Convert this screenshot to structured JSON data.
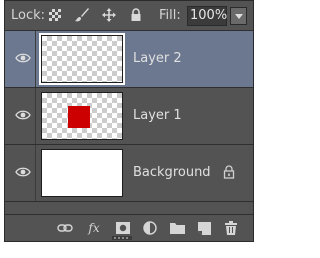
{
  "topbar": {
    "lock_label": "Lock:",
    "lock_icons": [
      "lock-transparent-pixels-icon",
      "lock-image-pixels-icon",
      "lock-position-icon",
      "lock-all-icon"
    ],
    "fill_label": "Fill:",
    "fill_value": "100%"
  },
  "layers": [
    {
      "name": "Layer 2",
      "selected": true,
      "thumbnail": "transparent",
      "visible": true,
      "locked": false
    },
    {
      "name": "Layer 1",
      "selected": false,
      "thumbnail": "red-square-on-transparent",
      "visible": true,
      "locked": false
    },
    {
      "name": "Background",
      "selected": false,
      "thumbnail": "white",
      "visible": true,
      "locked": true
    }
  ],
  "bottom_tools": [
    "link-layers-icon",
    "fx-icon",
    "add-mask-icon",
    "adjustment-layer-icon",
    "new-group-icon",
    "new-layer-icon",
    "delete-layer-icon"
  ],
  "bottom_fx_label": "fx",
  "colors": {
    "panel_bg": "#535353",
    "selected_row": "#6b7890",
    "red_square": "#cc0000"
  }
}
